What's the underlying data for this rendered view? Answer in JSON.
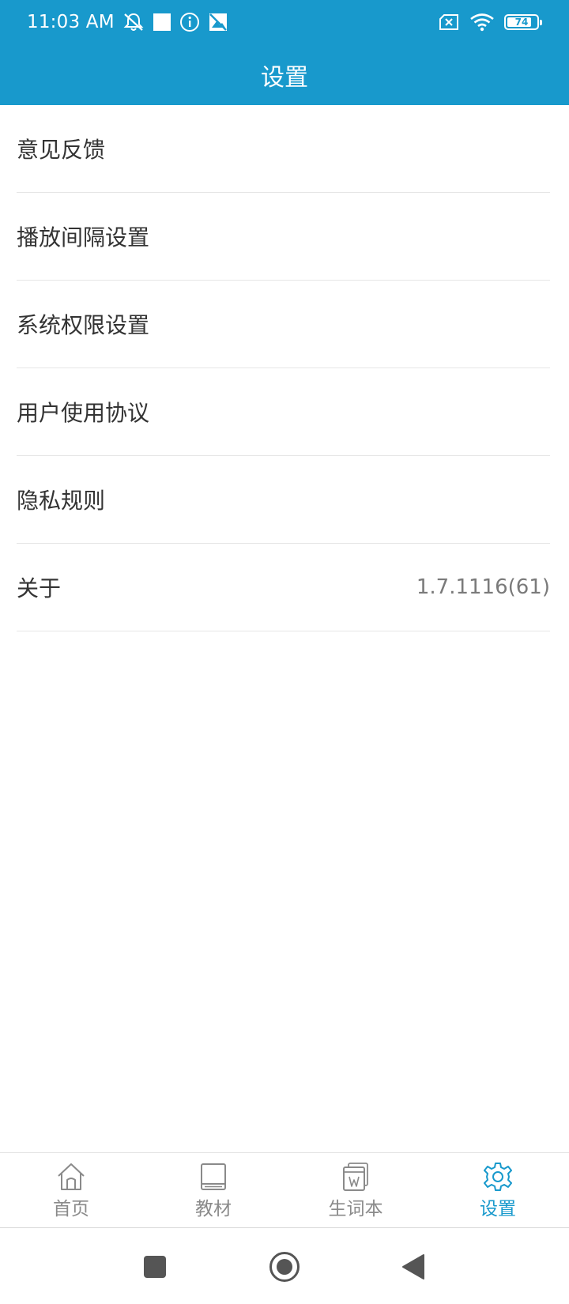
{
  "status_bar": {
    "time": "11:03 AM",
    "left_icons": [
      "mute-alert-icon",
      "square-notification-icon",
      "info-icon",
      "no-picture-icon"
    ],
    "right_icons": [
      "no-sim-icon",
      "wifi-icon"
    ],
    "battery_level": "74"
  },
  "app_bar": {
    "title": "设置"
  },
  "settings": {
    "items": [
      {
        "label": "意见反馈",
        "value": ""
      },
      {
        "label": "播放间隔设置",
        "value": ""
      },
      {
        "label": "系统权限设置",
        "value": ""
      },
      {
        "label": "用户使用协议",
        "value": ""
      },
      {
        "label": "隐私规则",
        "value": ""
      },
      {
        "label": "关于",
        "value": "1.7.1116(61)"
      }
    ]
  },
  "bottom_nav": {
    "active_index": 3,
    "active_color": "#1899cc",
    "inactive_color": "#8a8a8a",
    "items": [
      {
        "label": "首页",
        "icon": "home-icon"
      },
      {
        "label": "教材",
        "icon": "book-icon"
      },
      {
        "label": "生词本",
        "icon": "vocabulary-book-icon"
      },
      {
        "label": "设置",
        "icon": "gear-icon"
      }
    ]
  },
  "theme": {
    "primary": "#1899cc"
  },
  "system_nav": {
    "buttons": [
      "recents-button",
      "home-button",
      "back-button"
    ]
  }
}
